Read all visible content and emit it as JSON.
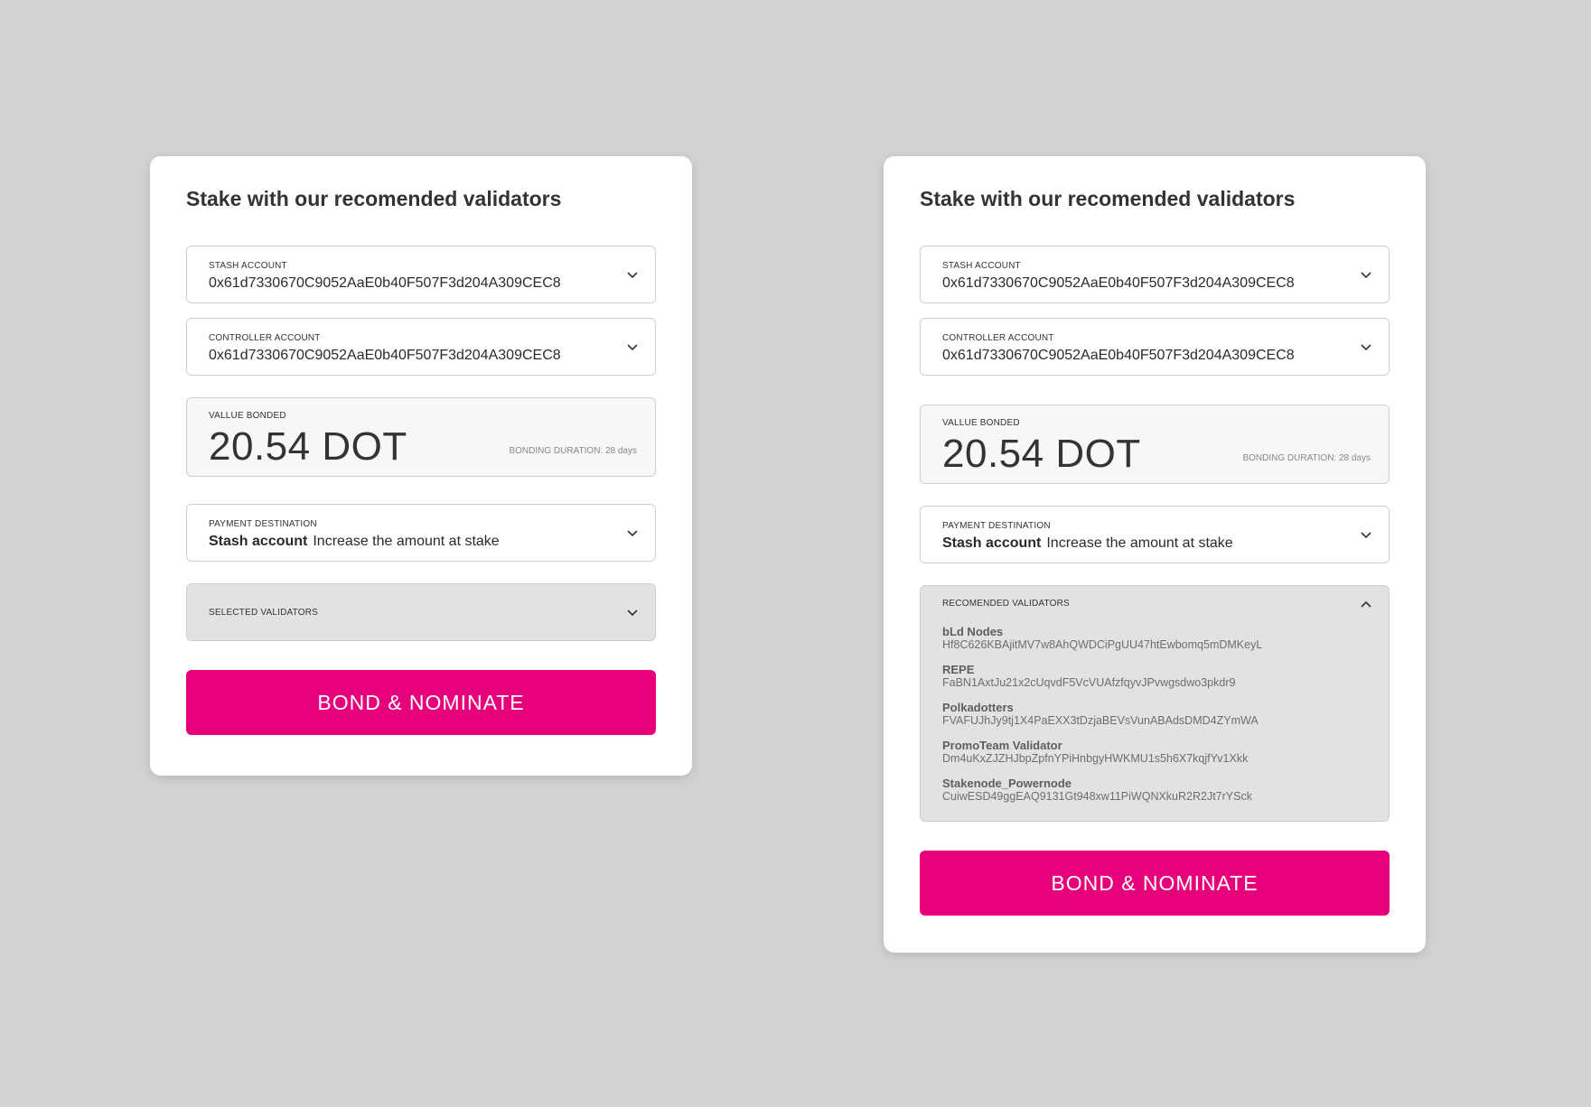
{
  "cards": {
    "left": {
      "title": "Stake with our recomended validators",
      "stash": {
        "label": "STASH ACCOUNT",
        "value": "0x61d7330670C9052AaE0b40F507F3d204A309CEC8"
      },
      "controller": {
        "label": "CONTROLLER ACCOUNT",
        "value": "0x61d7330670C9052AaE0b40F507F3d204A309CEC8"
      },
      "bonded": {
        "label": "VALLUE BONDED",
        "amount": "20.54 DOT",
        "duration": "BONDING DURATION: 28 days"
      },
      "payment": {
        "label": "PAYMENT DESTINATION",
        "destination": "Stash account",
        "description": "Increase the amount at stake"
      },
      "validators": {
        "label": "SELECTED VALIDATORS"
      },
      "button_label": "BOND & NOMINATE"
    },
    "right": {
      "title": "Stake with our recomended validators",
      "stash": {
        "label": "STASH ACCOUNT",
        "value": "0x61d7330670C9052AaE0b40F507F3d204A309CEC8"
      },
      "controller": {
        "label": "CONTROLLER ACCOUNT",
        "value": "0x61d7330670C9052AaE0b40F507F3d204A309CEC8"
      },
      "bonded": {
        "label": "VALLUE BONDED",
        "amount": "20.54 DOT",
        "duration": "BONDING DURATION: 28 days"
      },
      "payment": {
        "label": "PAYMENT DESTINATION",
        "destination": "Stash account",
        "description": "Increase the amount at stake"
      },
      "validators": {
        "label": "RECOMENDED VALIDATORS",
        "items": [
          {
            "name": "bLd Nodes",
            "address": "Hf8C626KBAjitMV7w8AhQWDCiPgUU47htEwbomq5mDMKeyL"
          },
          {
            "name": "REPE",
            "address": "FaBN1AxtJu21x2cUqvdF5VcVUAfzfqyvJPvwgsdwo3pkdr9"
          },
          {
            "name": "Polkadotters",
            "address": "FVAFUJhJy9tj1X4PaEXX3tDzjaBEVsVunABAdsDMD4ZYmWA"
          },
          {
            "name": "PromoTeam Validator",
            "address": "Dm4uKxZJZHJbpZpfnYPiHnbgyHWKMU1s5h6X7kqjfYv1Xkk"
          },
          {
            "name": "Stakenode_Powernode",
            "address": "CuiwESD49ggEAQ9131Gt948xw11PiWQNXkuR2R2Jt7rYSck"
          }
        ]
      },
      "button_label": "BOND & NOMINATE"
    }
  },
  "colors": {
    "accent": "#e6007a",
    "background": "#d2d2d2"
  },
  "icons": {
    "select": "chevron-down-icon",
    "collapse": "chevron-up-icon"
  }
}
